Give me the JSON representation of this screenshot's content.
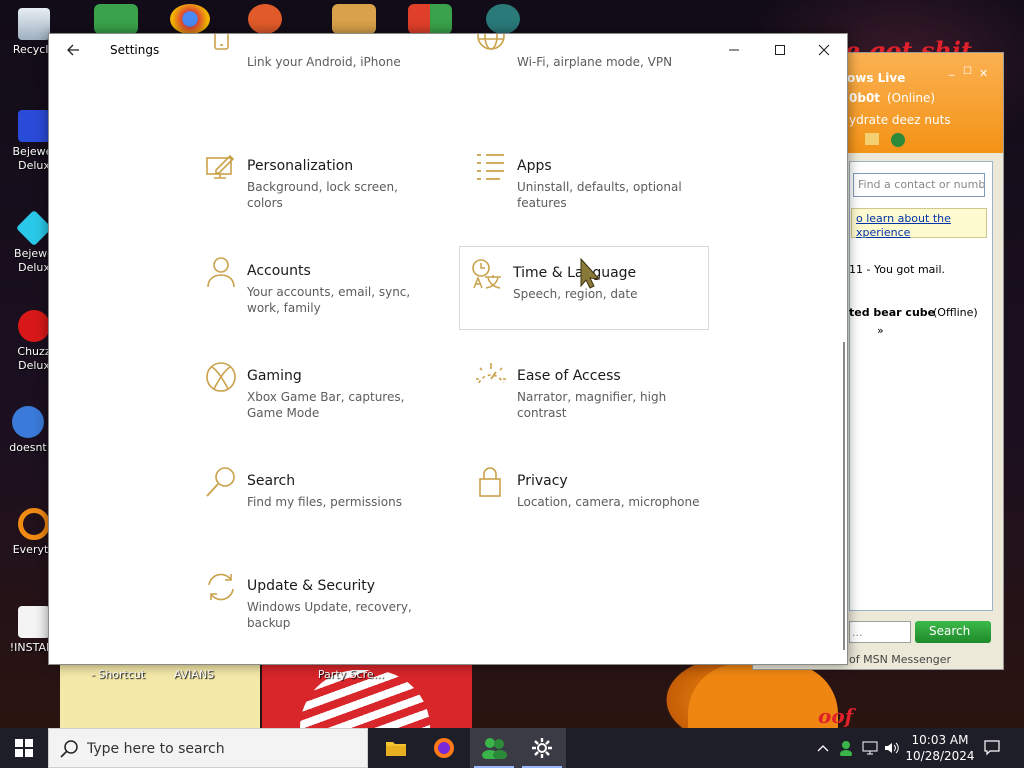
{
  "desktop": {
    "icons": [
      {
        "label": "Recycle"
      },
      {
        "label": "Bejewel Delux"
      },
      {
        "label": "Bejewe Delux"
      },
      {
        "label": "Chuzz Delux"
      },
      {
        "label": "doesnt"
      },
      {
        "label": "Everyth"
      },
      {
        "label": "!INSTALL"
      }
    ],
    "bottom_labels": [
      "- Shortcut",
      "AVIANS",
      "Party Scre..."
    ],
    "wallpaper_text": "e got shit",
    "pumpkin_text": "oof"
  },
  "msn": {
    "title": "ows Live",
    "user": "0b0t",
    "status": "(Online)",
    "personal_message": "ydrate deez nuts",
    "find_placeholder": "Find a contact or numbe",
    "link_line1": "o learn about the",
    "link_line2": "xperience",
    "mail_text": "11 - You got mail.",
    "contact_name": "ted bear cube",
    "contact_status": "(Offline)",
    "more": "»",
    "search_button": "Search",
    "search_field": "...",
    "footer": "of MSN Messenger"
  },
  "window": {
    "title": "Settings",
    "tiles": [
      {
        "title": "",
        "desc": "Link your Android, iPhone",
        "icon": "phone-icon"
      },
      {
        "title": "",
        "desc": "Wi-Fi, airplane mode, VPN",
        "icon": "globe-icon"
      },
      {
        "title": "Personalization",
        "desc": "Background, lock screen, colors",
        "icon": "personalization-icon"
      },
      {
        "title": "Apps",
        "desc": "Uninstall, defaults, optional features",
        "icon": "apps-list-icon"
      },
      {
        "title": "Accounts",
        "desc": "Your accounts, email, sync, work, family",
        "icon": "person-icon"
      },
      {
        "title": "Time & Language",
        "desc": "Speech, region, date",
        "icon": "time-language-icon"
      },
      {
        "title": "Gaming",
        "desc": "Xbox Game Bar, captures, Game Mode",
        "icon": "xbox-icon"
      },
      {
        "title": "Ease of Access",
        "desc": "Narrator, magnifier, high contrast",
        "icon": "ease-of-access-icon"
      },
      {
        "title": "Search",
        "desc": "Find my files, permissions",
        "icon": "search-icon"
      },
      {
        "title": "Privacy",
        "desc": "Location, camera, microphone",
        "icon": "lock-icon"
      },
      {
        "title": "Update & Security",
        "desc": "Windows Update, recovery, backup",
        "icon": "sync-icon"
      }
    ]
  },
  "taskbar": {
    "search_placeholder": "Type here to search",
    "time": "10:03 AM",
    "date": "10/28/2024"
  },
  "colors": {
    "accent": "#c9a24a",
    "taskbar": "#1e1e28"
  }
}
